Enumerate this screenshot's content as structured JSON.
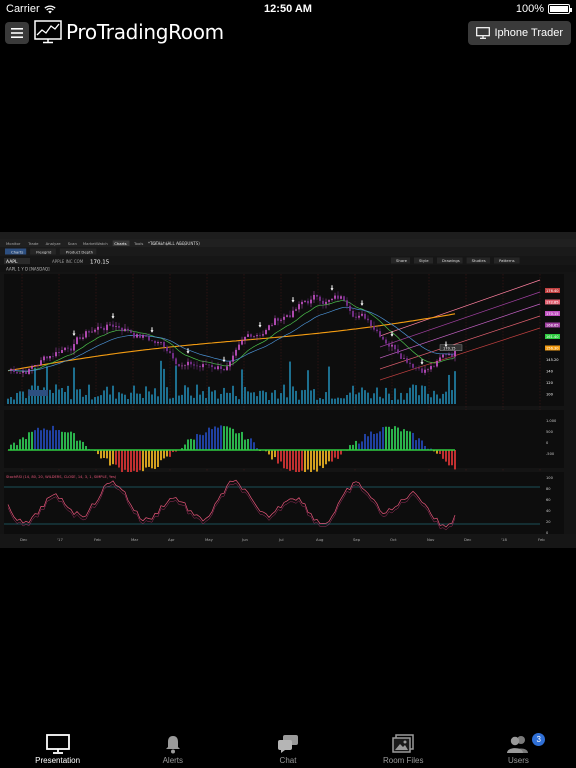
{
  "status_bar": {
    "carrier": "Carrier",
    "time": "12:50 AM",
    "battery": "100%"
  },
  "header": {
    "app_name": "ProTradingRoom",
    "iphone_trader_label": "Iphone Trader"
  },
  "platform": {
    "top_nav": [
      "Monitor",
      "Trade",
      "Analyze",
      "Scan",
      "MarketWatch",
      "Charts",
      "Tools",
      "Education",
      "Help"
    ],
    "chart_tabs": [
      "Charts",
      "Flexgrid",
      "Product Depth"
    ],
    "symbol": "AAPL",
    "exchange_label": "APPLE INC COM",
    "last_price": "170.15",
    "study_title": "AAPL 1 Y D [NASDAQ]",
    "account": "*TOTAL* (ALL ACCOUNTS)",
    "toolbar_buttons": [
      "Share",
      "Style",
      "Drawings",
      "Studies",
      "Patterns"
    ],
    "price_labels": [
      "176.40",
      "172.85",
      "170.15",
      "168.65",
      "161.40",
      "156.30",
      "145.20",
      "140",
      "120",
      "100"
    ],
    "price_callout": "170.15",
    "month_labels": [
      "Dec",
      "'17",
      "Feb",
      "Mar",
      "Apr",
      "May",
      "Jun",
      "Jul",
      "Aug",
      "Sep",
      "Oct",
      "Nov",
      "Dec",
      "'18",
      "Feb"
    ],
    "osc_labels": [
      "1.000",
      "500",
      "0",
      "-500"
    ],
    "stoch_labels": [
      "100",
      "80",
      "60",
      "40",
      "20",
      "0"
    ],
    "stoch_title": "StochRSI (14, 80, 20, WILDERS, CLOSE, 14, 3, 1, SIMPLE, Yes)"
  },
  "tabs": [
    {
      "label": "Presentation",
      "icon": "monitor-icon",
      "active": true
    },
    {
      "label": "Alerts",
      "icon": "bell-icon",
      "active": false
    },
    {
      "label": "Chat",
      "icon": "chat-bubbles-icon",
      "active": false
    },
    {
      "label": "Room Files",
      "icon": "image-files-icon",
      "active": false
    },
    {
      "label": "Users",
      "icon": "users-icon",
      "active": false,
      "badge": "3"
    }
  ],
  "colors": {
    "accent": "#2f6fd6",
    "price_up": "#2ecc40",
    "price_down": "#e03030",
    "ma_orange": "#f39c12",
    "stoch_line": "#e8567a"
  }
}
